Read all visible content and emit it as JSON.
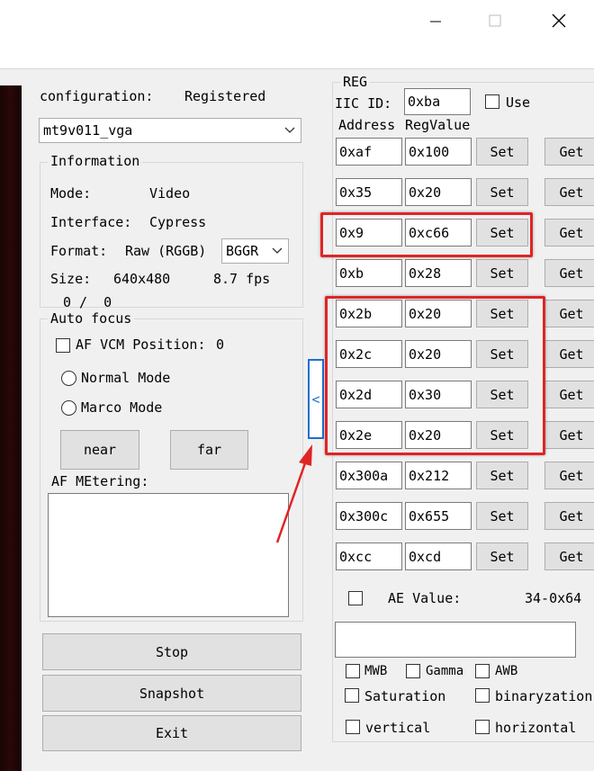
{
  "window": {
    "minimize_glyph": "—",
    "maximize_glyph": "☐",
    "close_glyph": "✕"
  },
  "left": {
    "configuration_label": "configuration:",
    "registered_label": "Registered",
    "sensor_select": "mt9v011_vga",
    "information": {
      "title": "Information",
      "mode_label": "Mode:",
      "mode_value": "Video",
      "interface_label": "Interface:",
      "interface_value": "Cypress",
      "format_label": "Format:",
      "format_value": "Raw (RGGB)",
      "bayer_select": "BGGR",
      "size_label": "Size:",
      "size_value": "640x480",
      "fps_value": "8.7 fps",
      "counter": "0 /  0"
    },
    "auto_focus": {
      "title": "Auto focus",
      "vcm_label": "AF VCM Position:",
      "vcm_value": "0",
      "normal_mode": "Normal Mode",
      "marco_mode": "Marco Mode",
      "near_label": "near",
      "far_label": "far",
      "metering_label": "AF MEtering:"
    },
    "stop_label": "Stop",
    "snapshot_label": "Snapshot",
    "exit_label": "Exit"
  },
  "collapse_glyph": "<",
  "reg": {
    "title": "REG",
    "iic_label": "IIC ID:",
    "iic_value": "0xba",
    "use_label": "Use",
    "address_header": "Address",
    "value_header": "RegValue",
    "set_label": "Set",
    "get_label": "Get",
    "rows": [
      {
        "address": "0xaf",
        "value": "0x100"
      },
      {
        "address": "0x35",
        "value": "0x20"
      },
      {
        "address": "0x9",
        "value": "0xc66"
      },
      {
        "address": "0xb",
        "value": "0x28"
      },
      {
        "address": "0x2b",
        "value": "0x20"
      },
      {
        "address": "0x2c",
        "value": "0x20"
      },
      {
        "address": "0x2d",
        "value": "0x30"
      },
      {
        "address": "0x2e",
        "value": "0x20"
      },
      {
        "address": "0x300a",
        "value": "0x212"
      },
      {
        "address": "0x300c",
        "value": "0x655"
      },
      {
        "address": "0xcc",
        "value": "0xcd"
      }
    ],
    "ae_label": "AE Value:",
    "ae_value": "34-0x64",
    "mwb_label": "MWB",
    "gamma_label": "Gamma",
    "awb_label": "AWB",
    "saturation_label": "Saturation",
    "binaryzation_label": "binaryzation",
    "vertical_label": "vertical",
    "horizontal_label": "horizontal"
  },
  "colors": {
    "highlight": "#e02424",
    "collapse_accent": "#1f6fd1"
  }
}
